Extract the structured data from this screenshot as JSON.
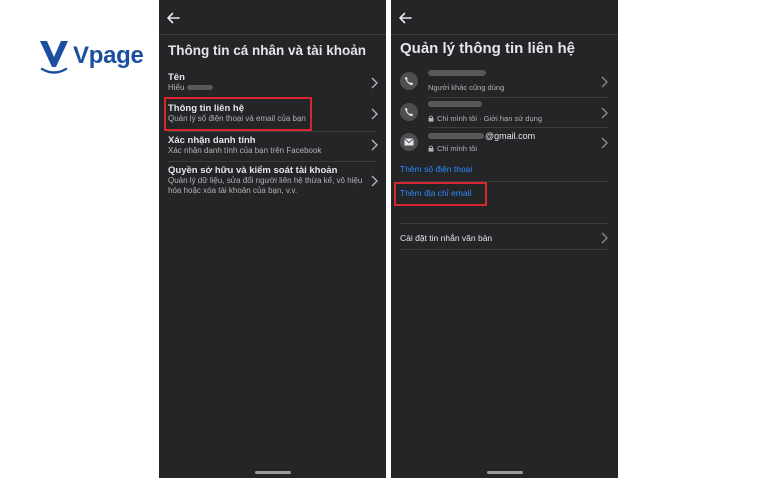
{
  "logo": {
    "text": "Vpage",
    "color": "#1c4fa0"
  },
  "left_screen": {
    "title": "Thông tin cá nhân và tài khoản",
    "items": [
      {
        "title": "Tên",
        "subtitle": "Hiếu"
      },
      {
        "title": "Thông tin liên hệ",
        "subtitle": "Quản lý số điện thoại và email của bạn",
        "highlighted": true
      },
      {
        "title": "Xác nhận danh tính",
        "subtitle": "Xác nhận danh tính của bạn trên Facebook"
      },
      {
        "title": "Quyền sở hữu và kiểm soát tài khoản",
        "subtitle": "Quản lý dữ liệu, sửa đổi người liên hệ thừa kế, vô hiệu hóa hoặc xóa tài khoản của bạn, v.v."
      }
    ]
  },
  "right_screen": {
    "title": "Quản lý thông tin liên hệ",
    "contacts": [
      {
        "icon": "phone-icon",
        "value_suffix": "",
        "subtitle": "Người khác cũng dùng",
        "lock": false
      },
      {
        "icon": "phone-icon",
        "value_suffix": "",
        "subtitle": "Chỉ mình tôi · Giới hạn sử dụng",
        "lock": true
      },
      {
        "icon": "email-icon",
        "value_suffix": "@gmail.com",
        "subtitle": "Chỉ mình tôi",
        "lock": true
      }
    ],
    "add_phone": "Thêm số điện thoại",
    "add_email": "Thêm địa chỉ email",
    "sms_settings": "Cài đặt tin nhắn văn bản"
  },
  "colors": {
    "screen_bg": "#242526",
    "link": "#2d88ff",
    "highlight": "#d8262e"
  }
}
